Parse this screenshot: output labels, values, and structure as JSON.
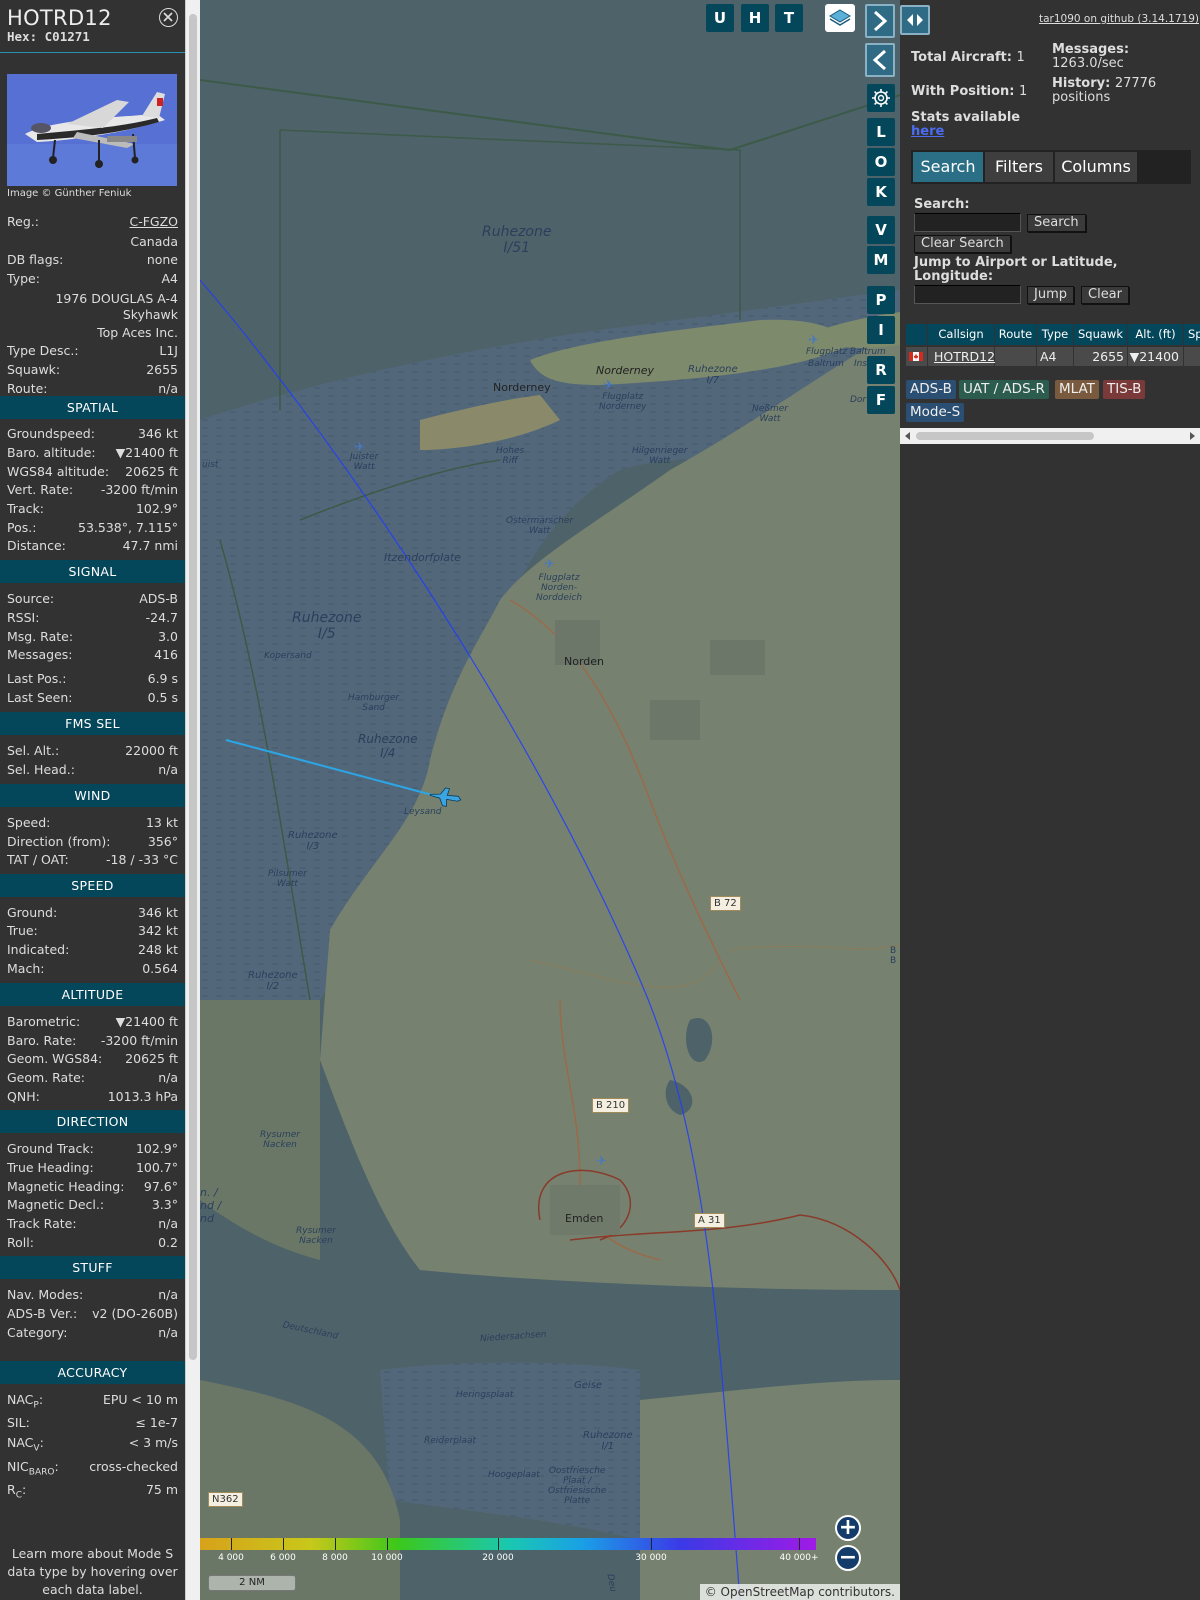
{
  "aircraft": {
    "callsign": "HOTRD12",
    "hex_label": "Hex:",
    "hex": "C01271",
    "photo_credit": "Image © Günther Feniuk",
    "reg_label": "Reg.:",
    "reg": "C-FGZO",
    "country": "Canada",
    "dbflags_label": "DB flags:",
    "dbflags": "none",
    "type_label": "Type:",
    "type": "A4",
    "type_full_1": "1976 DOUGLAS A-4",
    "type_full_2": "Skyhawk",
    "operator": "Top Aces Inc.",
    "typedesc_label": "Type Desc.:",
    "typedesc": "L1J",
    "squawk_label": "Squawk:",
    "squawk": "2655",
    "route_label": "Route:",
    "route": "n/a"
  },
  "sections": {
    "spatial": {
      "title": "SPATIAL",
      "rows": [
        {
          "label": "Groundspeed:",
          "value": "346 kt"
        },
        {
          "label": "Baro. altitude:",
          "value": "▼21400 ft"
        },
        {
          "label": "WGS84 altitude:",
          "value": "20625 ft"
        },
        {
          "label": "Vert. Rate:",
          "value": "-3200 ft/min"
        },
        {
          "label": "Track:",
          "value": "102.9°"
        },
        {
          "label": "Pos.:",
          "value": "53.538°, 7.115°"
        },
        {
          "label": "Distance:",
          "value": "47.7 nmi"
        }
      ]
    },
    "signal": {
      "title": "SIGNAL",
      "rows": [
        {
          "label": "Source:",
          "value": "ADS-B"
        },
        {
          "label": "RSSI:",
          "value": "-24.7"
        },
        {
          "label": "Msg. Rate:",
          "value": "3.0"
        },
        {
          "label": "Messages:",
          "value": "416"
        },
        {
          "label": "Last Pos.:",
          "value": "6.9 s"
        },
        {
          "label": "Last Seen:",
          "value": "0.5 s"
        }
      ]
    },
    "fms": {
      "title": "FMS SEL",
      "rows": [
        {
          "label": "Sel. Alt.:",
          "value": "22000 ft"
        },
        {
          "label": "Sel. Head.:",
          "value": "n/a"
        }
      ]
    },
    "wind": {
      "title": "WIND",
      "rows": [
        {
          "label": "Speed:",
          "value": "13 kt"
        },
        {
          "label": "Direction (from):",
          "value": "356°"
        },
        {
          "label": "TAT / OAT:",
          "value": "-18 / -33 °C"
        }
      ]
    },
    "speed": {
      "title": "SPEED",
      "rows": [
        {
          "label": "Ground:",
          "value": "346 kt"
        },
        {
          "label": "True:",
          "value": "342 kt"
        },
        {
          "label": "Indicated:",
          "value": "248 kt"
        },
        {
          "label": "Mach:",
          "value": "0.564"
        }
      ]
    },
    "altitude": {
      "title": "ALTITUDE",
      "rows": [
        {
          "label": "Barometric:",
          "value": "▼21400 ft"
        },
        {
          "label": "Baro. Rate:",
          "value": "-3200 ft/min"
        },
        {
          "label": "Geom. WGS84:",
          "value": "20625 ft"
        },
        {
          "label": "Geom. Rate:",
          "value": "n/a"
        },
        {
          "label": "QNH:",
          "value": "1013.3 hPa"
        }
      ]
    },
    "direction": {
      "title": "DIRECTION",
      "rows": [
        {
          "label": "Ground Track:",
          "value": "102.9°"
        },
        {
          "label": "True Heading:",
          "value": "100.7°"
        },
        {
          "label": "Magnetic Heading:",
          "value": "97.6°"
        },
        {
          "label": "Magnetic Decl.:",
          "value": "3.3°"
        },
        {
          "label": "Track Rate:",
          "value": "n/a"
        },
        {
          "label": "Roll:",
          "value": "0.2"
        }
      ]
    },
    "stuff": {
      "title": "STUFF",
      "rows": [
        {
          "label": "Nav. Modes:",
          "value": "n/a"
        },
        {
          "label": "ADS-B Ver.:",
          "value": "v2 (DO-260B)"
        },
        {
          "label": "Category:",
          "value": "n/a"
        }
      ]
    },
    "accuracy": {
      "title": "ACCURACY",
      "rows": [
        {
          "label": "NAC",
          "sub": "P",
          "label_after": ":",
          "value": "EPU < 10 m"
        },
        {
          "label": "SIL:",
          "sub": "",
          "label_after": "",
          "value": "≤ 1e-7"
        },
        {
          "label": "NAC",
          "sub": "V",
          "label_after": ":",
          "value": "< 3 m/s"
        },
        {
          "label": "NIC",
          "sub": "BARO",
          "label_after": ":",
          "value": "cross-checked"
        },
        {
          "label": "R",
          "sub": "C",
          "label_after": ":",
          "value": "75 m"
        }
      ]
    }
  },
  "info_footer": [
    "Learn more about Mode S",
    "data type by hovering over",
    "each data label."
  ],
  "map": {
    "labels": {
      "ruhezone_i51_a": "Ruhezone",
      "ruhezone_i51_b": "I/51",
      "ruhezone_i5_a": "Ruhezone",
      "ruhezone_i5_b": "I/5",
      "ruhezone_i4_a": "Ruhezone",
      "ruhezone_i4_b": "I/4",
      "ruhezone_i3_a": "Ruhezone",
      "ruhezone_i3_b": "I/3",
      "ruhezone_i2_a": "Ruhezone",
      "ruhezone_i2_b": "I/2",
      "ruhezone_i1_a": "Ruhezone",
      "ruhezone_i1_b": "I/1",
      "ruhezone_i7_a": "Ruhezone",
      "ruhezone_i7_b": "I/7",
      "norderney_town": "Norderney",
      "norderney_island": "Norderney",
      "flugplatz_norderney_a": "Flugplatz",
      "flugplatz_norderney_b": "Norderney",
      "flugplatz_baltrum": "Flugplatz Baltrum",
      "baltrum": "Baltrum",
      "ins": "Ins",
      "juister_a": "Juister",
      "juister_b": "Watt",
      "uist": "uist",
      "hohes_a": "Hohes",
      "hohes_b": "Riff",
      "hilgenrieger_a": "Hilgenrieger",
      "hilgenrieger_b": "Watt",
      "nessmer_a": "Neßmer",
      "nessmer_b": "Watt",
      "ostermarscher_a": "Ostermarscher",
      "ostermarscher_b": "Watt",
      "itzendorfplate": "Itzendorfplate",
      "flugplatz_norden_a": "Flugplatz",
      "flugplatz_norden_b": "Norden-",
      "flugplatz_norden_c": "Norddeich",
      "norden": "Norden",
      "kopersand": "Kopersand",
      "hamburger_a": "Hamburger",
      "hamburger_b": "Sand",
      "leysand": "Leysand",
      "pilsumer_a": "Pilsumer",
      "pilsumer_b": "Watt",
      "rysumer_a": "Rysumer",
      "rysumer_b": "Nacken",
      "rysumer2_a": "Rysumer",
      "rysumer2_b": "Nacken",
      "emden": "Emden",
      "deutschland": "Deutschland",
      "niedersachsen": "Niedersachsen",
      "geise": "Geise",
      "heringsplaat": "Heringsplaat",
      "reiderplaat": "Reiderplaat",
      "hoogeplaat": "Hoogeplaat",
      "oostfriesche_a": "Oostfriesche",
      "oostfriesche_b": "Plaat /",
      "oostfriesche_c": "Ostfriesische",
      "oostfriesche_d": "Platte",
      "dor": "Dor",
      "b_east_a": "B",
      "b_east_b": "B",
      "nd_a": "n. /",
      "nd_b": "nd /",
      "nd_c": "nd",
      "deu": "Deu"
    },
    "road_badges": {
      "b72": "B 72",
      "b210": "B 210",
      "a31": "A 31",
      "n362": "N362"
    },
    "altitude_legend": [
      "4 000",
      "6 000",
      "8 000",
      "10 000",
      "20 000",
      "30 000",
      "40 000+"
    ],
    "scale_label": "2 NM",
    "attribution": "© OpenStreetMap contributors.",
    "map_buttons": [
      "U",
      "H",
      "T"
    ],
    "side_buttons": [
      "L",
      "O",
      "K",
      "V",
      "M",
      "P",
      "I",
      "R",
      "F"
    ]
  },
  "sidebar": {
    "github_link": "tar1090 on github (3.14.1719)",
    "total_label": "Total Aircraft:",
    "total": "1",
    "messages_label": "Messages:",
    "messages": "1263.0/sec",
    "withpos_label": "With Position:",
    "withpos": "1",
    "history_label": "History:",
    "history_a": "27776",
    "history_b": "positions",
    "stats_label": "Stats available",
    "stats_link": "here",
    "tabs": [
      "Search",
      "Filters",
      "Columns"
    ],
    "search_label": "Search:",
    "search_button": "Search",
    "clear_search_button": "Clear Search",
    "jump_label_1": "Jump to Airport or Latitude,",
    "jump_label_2": "Longitude:",
    "jump_button": "Jump",
    "clear_button": "Clear",
    "table_headers": [
      "Callsign",
      "Route",
      "Type",
      "Squawk",
      "Alt. (ft)",
      "Sp"
    ],
    "table_row": {
      "callsign": "HOTRD12",
      "route": "",
      "type": "A4",
      "squawk": "2655",
      "alt": "▼21400"
    },
    "source_tags": [
      "ADS-B",
      "UAT / ADS-R",
      "MLAT",
      "TIS-B",
      "Mode-S"
    ]
  },
  "colors": {
    "section_bg": "#04465a",
    "trail": "#2ba6e6",
    "aircraft": "#3aa5e0",
    "tag_adsb": "#2b4f73",
    "tag_uat": "#2c5c4e",
    "tag_mlat": "#7a5a3e",
    "tag_tisb": "#7a3a3a",
    "tag_modes": "#2b4f73"
  }
}
